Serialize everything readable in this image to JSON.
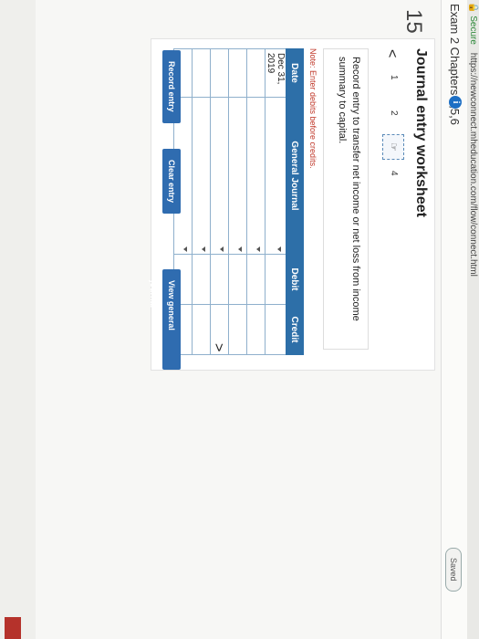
{
  "browser": {
    "secure_label": "Secure",
    "url": "https://newconnect.mheducation.com/flow/connect.html"
  },
  "header": {
    "exam_title": "Exam 2 Chapters 4,5,6",
    "info_glyph": "i",
    "saved_label": "Saved"
  },
  "question": {
    "number": "15",
    "title": "Journal entry worksheet",
    "nav_prev": "<",
    "nav_next": ">",
    "steps": [
      "1",
      "2",
      "3",
      "4"
    ],
    "active_step": 3,
    "instruction": "Record entry to transfer net income or net loss from income summary to capital.",
    "note": "Note: Enter debits before credits."
  },
  "journal": {
    "headers": {
      "date": "Date",
      "account": "General Journal",
      "debit": "Debit",
      "credit": "Credit"
    },
    "rows": [
      {
        "date": "Dec 31, 2019",
        "account": "",
        "debit": "",
        "credit": ""
      },
      {
        "date": "",
        "account": "",
        "debit": "",
        "credit": ""
      },
      {
        "date": "",
        "account": "",
        "debit": "",
        "credit": ""
      },
      {
        "date": "",
        "account": "",
        "debit": "",
        "credit": ""
      },
      {
        "date": "",
        "account": "",
        "debit": "",
        "credit": ""
      },
      {
        "date": "",
        "account": "",
        "debit": "",
        "credit": ""
      }
    ]
  },
  "buttons": {
    "record": "Record entry",
    "clear": "Clear entry",
    "view": "View general journal"
  },
  "colors": {
    "primary_blue": "#2d6fa8",
    "note_red": "#c0392b",
    "info_blue": "#1d6fc4"
  }
}
